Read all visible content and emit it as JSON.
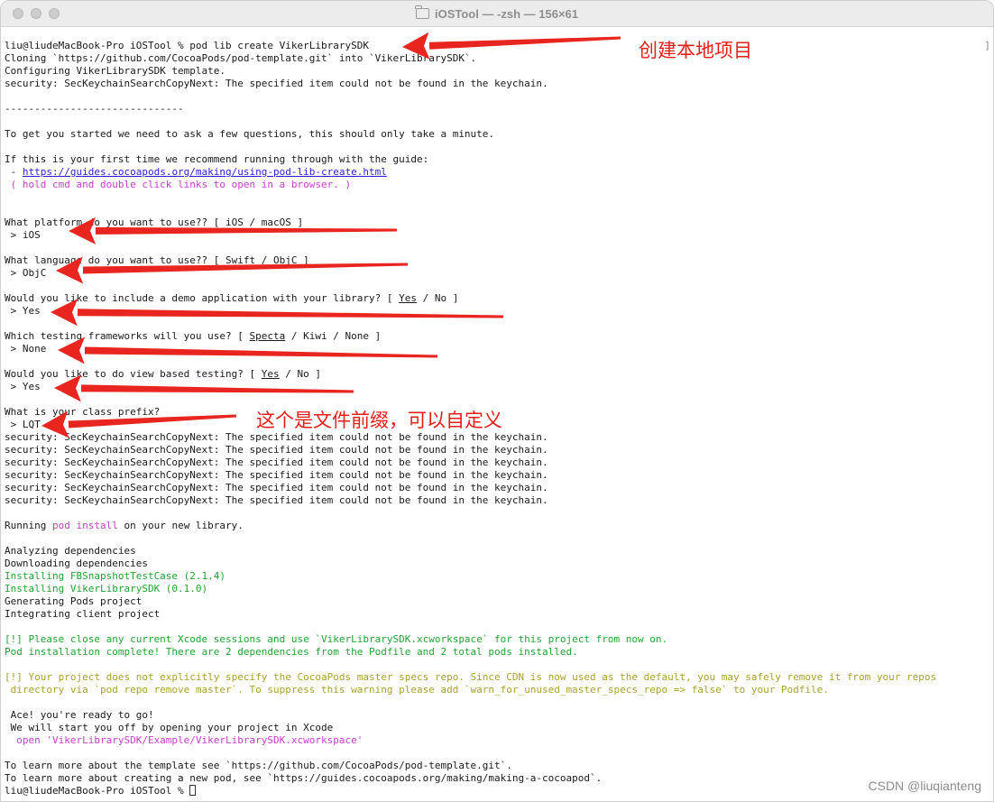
{
  "window": {
    "title": "iOSTool — -zsh — 156×61"
  },
  "terminal": {
    "lines": [
      {
        "segments": [
          {
            "t": "liu@liudeMacBook-Pro iOSTool % pod lib create VikerLibrarySDK"
          }
        ]
      },
      {
        "segments": [
          {
            "t": "Cloning `https://github.com/CocoaPods/pod-template.git` into `VikerLibrarySDK`."
          }
        ]
      },
      {
        "segments": [
          {
            "t": "Configuring VikerLibrarySDK template."
          }
        ]
      },
      {
        "segments": [
          {
            "t": "security: SecKeychainSearchCopyNext: The specified item could not be found in the keychain."
          }
        ]
      },
      {
        "segments": [
          {
            "t": ""
          }
        ]
      },
      {
        "segments": [
          {
            "t": "------------------------------"
          }
        ]
      },
      {
        "segments": [
          {
            "t": ""
          }
        ]
      },
      {
        "segments": [
          {
            "t": "To get you started we need to ask a few questions, this should only take a minute."
          }
        ]
      },
      {
        "segments": [
          {
            "t": ""
          }
        ]
      },
      {
        "segments": [
          {
            "t": "If this is your first time we recommend running through with the guide:"
          }
        ]
      },
      {
        "segments": [
          {
            "t": " - "
          },
          {
            "t": "https://guides.cocoapods.org/making/using-pod-lib-create.html",
            "c": "lnk"
          }
        ]
      },
      {
        "segments": [
          {
            "t": " ( hold cmd and double click links to open in a browser. )",
            "c": "m"
          }
        ]
      },
      {
        "segments": [
          {
            "t": ""
          }
        ]
      },
      {
        "segments": [
          {
            "t": ""
          }
        ]
      },
      {
        "segments": [
          {
            "t": "What platform do you want to use?? [ iOS / macOS ]"
          }
        ]
      },
      {
        "segments": [
          {
            "t": " > iOS"
          }
        ]
      },
      {
        "segments": [
          {
            "t": ""
          }
        ]
      },
      {
        "segments": [
          {
            "t": "What language do you want to use?? [ Swift / ObjC ]"
          }
        ]
      },
      {
        "segments": [
          {
            "t": " > ObjC"
          }
        ]
      },
      {
        "segments": [
          {
            "t": ""
          }
        ]
      },
      {
        "segments": [
          {
            "t": "Would you like to include a demo application with your library? [ "
          },
          {
            "t": "Yes",
            "c": "u"
          },
          {
            "t": " / No ]"
          }
        ]
      },
      {
        "segments": [
          {
            "t": " > Yes"
          }
        ]
      },
      {
        "segments": [
          {
            "t": ""
          }
        ]
      },
      {
        "segments": [
          {
            "t": "Which testing frameworks will you use? [ "
          },
          {
            "t": "Specta",
            "c": "u"
          },
          {
            "t": " / Kiwi / None ]"
          }
        ]
      },
      {
        "segments": [
          {
            "t": " > None"
          }
        ]
      },
      {
        "segments": [
          {
            "t": ""
          }
        ]
      },
      {
        "segments": [
          {
            "t": "Would you like to do view based testing? [ "
          },
          {
            "t": "Yes",
            "c": "u"
          },
          {
            "t": " / No ]"
          }
        ]
      },
      {
        "segments": [
          {
            "t": " > Yes"
          }
        ]
      },
      {
        "segments": [
          {
            "t": ""
          }
        ]
      },
      {
        "segments": [
          {
            "t": "What is your class prefix?"
          }
        ]
      },
      {
        "segments": [
          {
            "t": " > LQT"
          }
        ]
      },
      {
        "segments": [
          {
            "t": "security: SecKeychainSearchCopyNext: The specified item could not be found in the keychain."
          }
        ]
      },
      {
        "segments": [
          {
            "t": "security: SecKeychainSearchCopyNext: The specified item could not be found in the keychain."
          }
        ]
      },
      {
        "segments": [
          {
            "t": "security: SecKeychainSearchCopyNext: The specified item could not be found in the keychain."
          }
        ]
      },
      {
        "segments": [
          {
            "t": "security: SecKeychainSearchCopyNext: The specified item could not be found in the keychain."
          }
        ]
      },
      {
        "segments": [
          {
            "t": "security: SecKeychainSearchCopyNext: The specified item could not be found in the keychain."
          }
        ]
      },
      {
        "segments": [
          {
            "t": "security: SecKeychainSearchCopyNext: The specified item could not be found in the keychain."
          }
        ]
      },
      {
        "segments": [
          {
            "t": ""
          }
        ]
      },
      {
        "segments": [
          {
            "t": "Running "
          },
          {
            "t": "pod install",
            "c": "m"
          },
          {
            "t": " on your new library."
          }
        ]
      },
      {
        "segments": [
          {
            "t": ""
          }
        ]
      },
      {
        "segments": [
          {
            "t": "Analyzing dependencies"
          }
        ]
      },
      {
        "segments": [
          {
            "t": "Downloading dependencies"
          }
        ]
      },
      {
        "segments": [
          {
            "t": "Installing FBSnapshotTestCase (2.1.4)",
            "c": "g"
          }
        ]
      },
      {
        "segments": [
          {
            "t": "Installing VikerLibrarySDK (0.1.0)",
            "c": "g"
          }
        ]
      },
      {
        "segments": [
          {
            "t": "Generating Pods project"
          }
        ]
      },
      {
        "segments": [
          {
            "t": "Integrating client project"
          }
        ]
      },
      {
        "segments": [
          {
            "t": ""
          }
        ]
      },
      {
        "segments": [
          {
            "t": "[!] Please close any current Xcode sessions and use `VikerLibrarySDK.xcworkspace` for this project from now on.",
            "c": "g"
          }
        ]
      },
      {
        "segments": [
          {
            "t": "Pod installation complete! There are 2 dependencies from the Podfile and 2 total pods installed.",
            "c": "g"
          }
        ]
      },
      {
        "segments": [
          {
            "t": ""
          }
        ]
      },
      {
        "segments": [
          {
            "t": "[!] Your project does not explicitly specify the CocoaPods master specs repo. Since CDN is now used as the default, you may safely remove it from your repos",
            "c": "y"
          }
        ]
      },
      {
        "segments": [
          {
            "t": " directory via `pod repo remove master`. To suppress this warning please add `warn_for_unused_master_specs_repo => false` to your Podfile.",
            "c": "y"
          }
        ]
      },
      {
        "segments": [
          {
            "t": ""
          }
        ]
      },
      {
        "segments": [
          {
            "t": " Ace! you're ready to go!"
          }
        ]
      },
      {
        "segments": [
          {
            "t": " We will start you off by opening your project in Xcode"
          }
        ]
      },
      {
        "segments": [
          {
            "t": "  open 'VikerLibrarySDK/Example/VikerLibrarySDK.xcworkspace'",
            "c": "m"
          }
        ]
      },
      {
        "segments": [
          {
            "t": ""
          }
        ]
      },
      {
        "segments": [
          {
            "t": "To learn more about the template see `https://github.com/CocoaPods/pod-template.git`."
          }
        ]
      },
      {
        "segments": [
          {
            "t": "To learn more about creating a new pod, see `https://guides.cocoapods.org/making/making-a-cocoapod`."
          }
        ]
      },
      {
        "segments": [
          {
            "t": "liu@liudeMacBook-Pro iOSTool % "
          }
        ],
        "cursor": true
      }
    ],
    "right_mark": "]"
  },
  "annotations": {
    "create_local_project": "创建本地项目",
    "file_prefix_note": "这个是文件前缀，可以自定义"
  },
  "arrow_color": "#e8251e",
  "watermark": "CSDN @liuqianteng"
}
